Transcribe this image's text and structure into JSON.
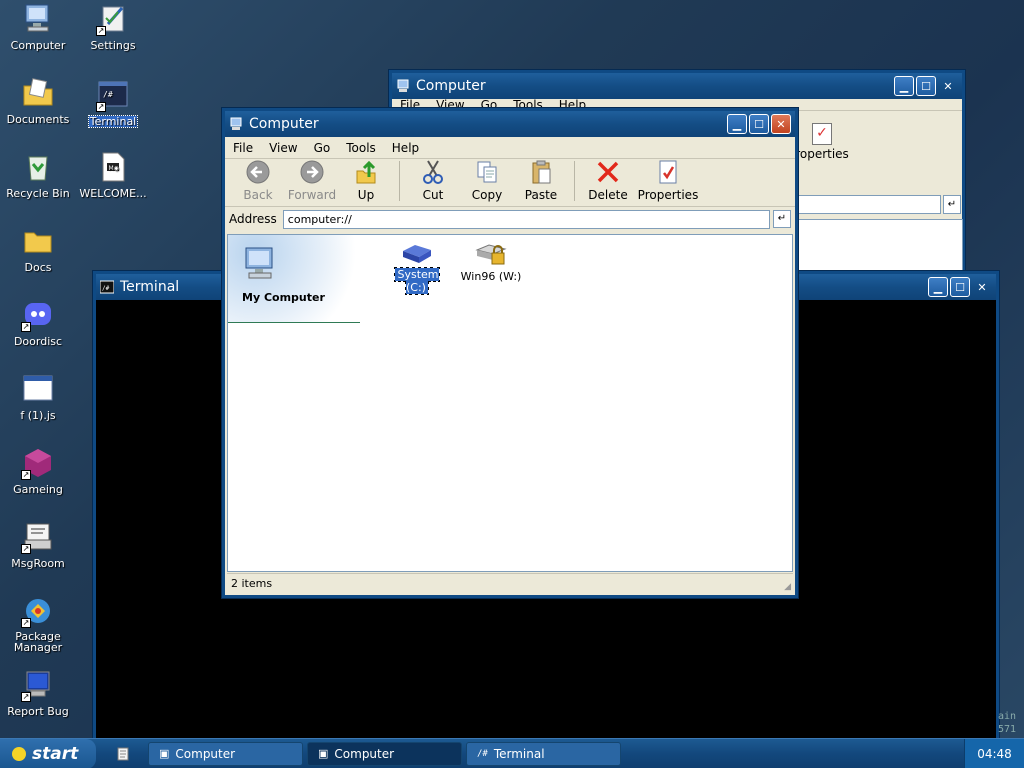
{
  "desktop": {
    "icons": [
      {
        "label": "Computer"
      },
      {
        "label": "Settings"
      },
      {
        "label": "Documents"
      },
      {
        "label": "Terminal"
      },
      {
        "label": "Recycle Bin"
      },
      {
        "label": "WELCOME..."
      },
      {
        "label": "Docs"
      },
      {
        "label": "Doordisc"
      },
      {
        "label": "f (1).js"
      },
      {
        "label": "Gameing"
      },
      {
        "label": "MsgRoom"
      },
      {
        "label": "Package Manager"
      },
      {
        "label": "Report Bug"
      }
    ]
  },
  "back_window": {
    "title": "Computer",
    "menu": [
      "File",
      "View",
      "Go",
      "Tools",
      "Help"
    ],
    "properties_label": "roperties"
  },
  "terminal_window": {
    "title": "Terminal",
    "side_text_1": "ain",
    "side_text_2": "571"
  },
  "front_window": {
    "title": "Computer",
    "menu": [
      "File",
      "View",
      "Go",
      "Tools",
      "Help"
    ],
    "toolbar": {
      "back": "Back",
      "forward": "Forward",
      "up": "Up",
      "cut": "Cut",
      "copy": "Copy",
      "paste": "Paste",
      "delete": "Delete",
      "properties": "Properties"
    },
    "address_label": "Address",
    "address_value": "computer://",
    "sidebar_title": "My Computer",
    "items": [
      {
        "label": "System (C:)",
        "icon": "drive-icon"
      },
      {
        "label": "Win96 (W:)",
        "icon": "locked-drive-icon"
      }
    ],
    "status": "2 items"
  },
  "taskbar": {
    "start_label": "start",
    "tasks": [
      {
        "label": "Computer"
      },
      {
        "label": "Computer"
      },
      {
        "label": "Terminal"
      }
    ],
    "clock": "04:48"
  },
  "colors": {
    "titlebar": "#144d85",
    "accent": "#316ac5",
    "close": "#c1421f"
  }
}
